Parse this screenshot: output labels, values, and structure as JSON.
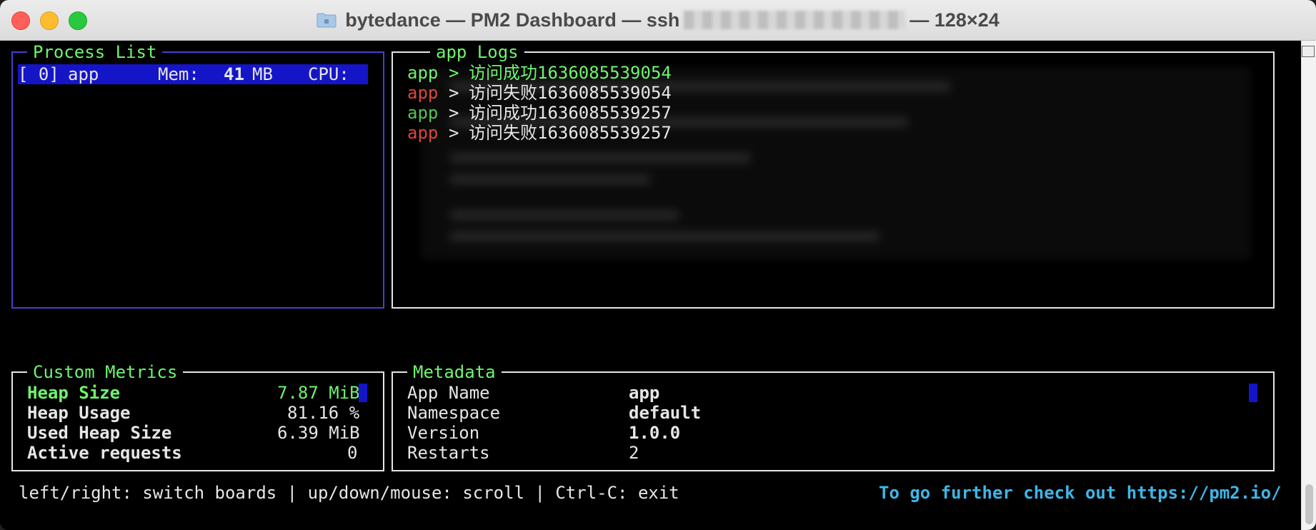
{
  "window": {
    "title_prefix": "bytedance — PM2 Dashboard — ssh",
    "title_suffix": "— 128×24"
  },
  "process_list": {
    "label": "Process List",
    "row": {
      "index": "[ 0]",
      "name": "app",
      "mem_label": "Mem:",
      "mem_value": "41",
      "mem_unit": "MB",
      "cpu_label": "CPU:"
    }
  },
  "logs": {
    "label": "app Logs",
    "lines": [
      {
        "prefix": "app",
        "sep": ">",
        "message": "访问成功1636085539054",
        "status": "success"
      },
      {
        "prefix": "app",
        "sep": ">",
        "message": "访问失败1636085539054",
        "status": "error"
      },
      {
        "prefix": "app",
        "sep": ">",
        "message": "访问成功1636085539257",
        "status": "success"
      },
      {
        "prefix": "app",
        "sep": ">",
        "message": "访问失败1636085539257",
        "status": "error"
      }
    ]
  },
  "custom_metrics": {
    "label": "Custom Metrics",
    "items": [
      {
        "name": "Heap Size",
        "value": "7.87 MiB"
      },
      {
        "name": "Heap Usage",
        "value": "81.16 %"
      },
      {
        "name": "Used Heap Size",
        "value": "6.39 MiB"
      },
      {
        "name": "Active requests",
        "value": "0"
      }
    ]
  },
  "metadata": {
    "label": "Metadata",
    "items": [
      {
        "key": "App Name",
        "value": "app"
      },
      {
        "key": "Namespace",
        "value": "default"
      },
      {
        "key": "Version",
        "value": "1.0.0"
      },
      {
        "key": "Restarts",
        "value": "2"
      }
    ]
  },
  "footer": {
    "help": "left/right: switch boards | up/down/mouse: scroll | Ctrl-C: exit",
    "link_text": "To go further check out https://pm2.io/"
  },
  "colors": {
    "green": "#6ef46e",
    "red": "#e0463c",
    "blue_border": "#4a3ccf",
    "highlight": "#1515c8",
    "cyan": "#3fb5e6"
  }
}
